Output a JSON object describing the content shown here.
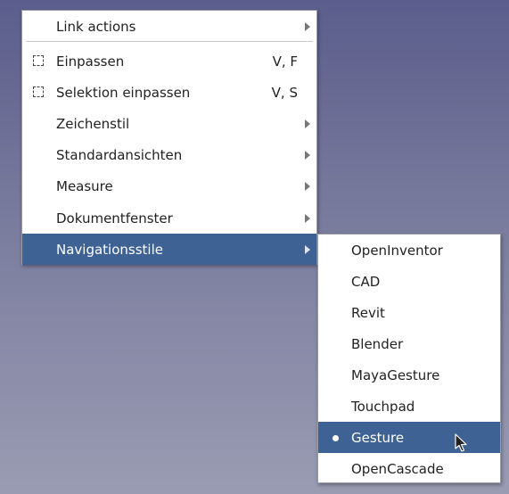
{
  "main_menu": {
    "items": [
      {
        "label": "Link actions",
        "shortcut": "",
        "has_submenu": true,
        "icon": ""
      },
      {
        "label": "Einpassen",
        "shortcut": "V, F",
        "has_submenu": false,
        "icon": "fit-all-icon"
      },
      {
        "label": "Selektion einpassen",
        "shortcut": "V, S",
        "has_submenu": false,
        "icon": "fit-selection-icon"
      },
      {
        "label": "Zeichenstil",
        "shortcut": "",
        "has_submenu": true,
        "icon": ""
      },
      {
        "label": "Standardansichten",
        "shortcut": "",
        "has_submenu": true,
        "icon": ""
      },
      {
        "label": "Measure",
        "shortcut": "",
        "has_submenu": true,
        "icon": ""
      },
      {
        "label": "Dokumentfenster",
        "shortcut": "",
        "has_submenu": true,
        "icon": ""
      },
      {
        "label": "Navigationsstile",
        "shortcut": "",
        "has_submenu": true,
        "icon": "",
        "highlighted": true
      }
    ]
  },
  "sub_menu": {
    "items": [
      {
        "label": "OpenInventor"
      },
      {
        "label": "CAD"
      },
      {
        "label": "Revit"
      },
      {
        "label": "Blender"
      },
      {
        "label": "MayaGesture"
      },
      {
        "label": "Touchpad"
      },
      {
        "label": "Gesture",
        "selected": true,
        "highlighted": true
      },
      {
        "label": "OpenCascade"
      }
    ]
  },
  "colors": {
    "highlight": "#3f6294",
    "menu_background": "#ffffff",
    "text": "#222222"
  }
}
